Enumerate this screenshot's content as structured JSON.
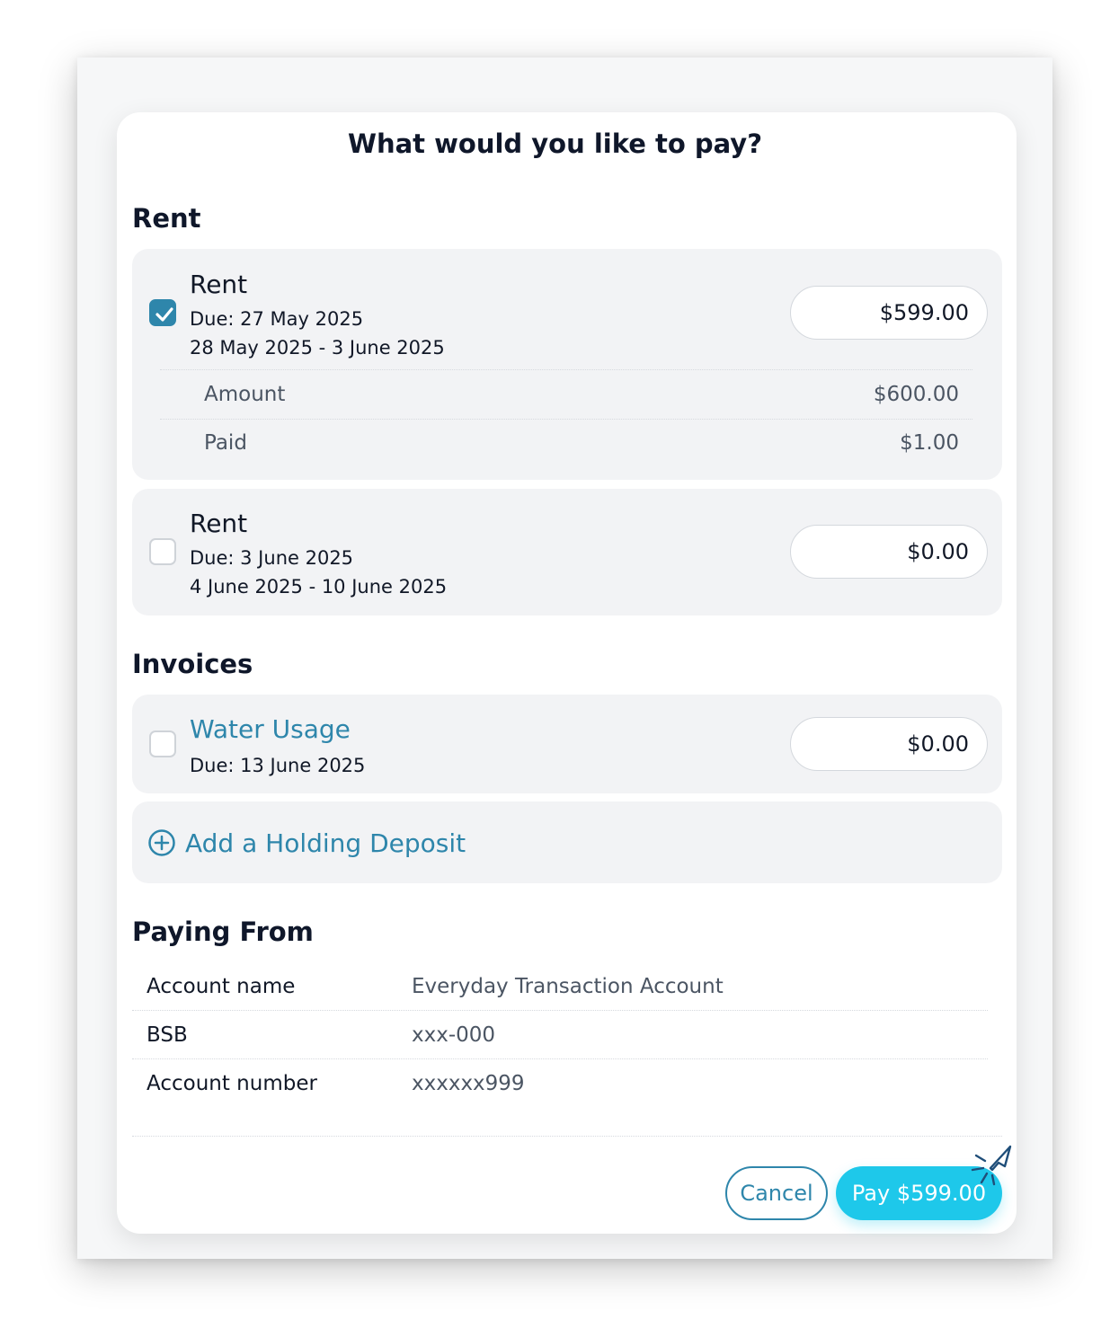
{
  "modal": {
    "title": "What would you like to pay?"
  },
  "rent_section": {
    "heading": "Rent",
    "items": [
      {
        "title": "Rent",
        "due": "Due: 27 May 2025",
        "period": "28 May 2025 - 3 June 2025",
        "amount_input": "$599.00",
        "checked": true,
        "breakdown": [
          {
            "label": "Amount",
            "value": "$600.00"
          },
          {
            "label": "Paid",
            "value": "$1.00"
          }
        ]
      },
      {
        "title": "Rent",
        "due": "Due: 3 June 2025",
        "period": "4 June 2025 - 10 June 2025",
        "amount_input": "$0.00",
        "checked": false
      }
    ]
  },
  "invoices_section": {
    "heading": "Invoices",
    "items": [
      {
        "title": "Water Usage",
        "due": "Due: 13 June 2025",
        "amount_input": "$0.00",
        "checked": false
      }
    ],
    "add_deposit_label": "Add a Holding Deposit"
  },
  "paying_from": {
    "heading": "Paying From",
    "rows": [
      {
        "label": "Account name",
        "value": "Everyday Transaction Account"
      },
      {
        "label": "BSB",
        "value": "xxx-000"
      },
      {
        "label": "Account number",
        "value": "xxxxxx999"
      }
    ]
  },
  "actions": {
    "cancel_label": "Cancel",
    "pay_label": "Pay $599.00"
  },
  "colors": {
    "accent": "#2e86ab",
    "pay_button": "#1ec8ea",
    "card_background": "#f2f3f5"
  },
  "icons": {
    "checkbox_check": "check-icon",
    "add_deposit": "plus-circle-icon",
    "cursor": "click-cursor-icon"
  }
}
